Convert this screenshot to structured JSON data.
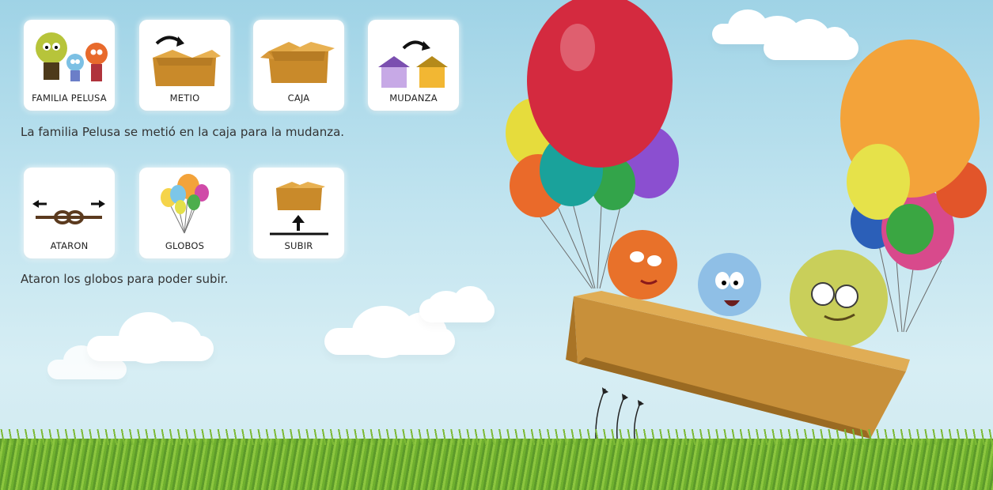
{
  "row1": {
    "cards": [
      {
        "label": "FAMILIA PELUSA",
        "icon": "pelusa-family-icon"
      },
      {
        "label": "METIO",
        "icon": "put-in-box-icon"
      },
      {
        "label": "CAJA",
        "icon": "box-icon"
      },
      {
        "label": "MUDANZA",
        "icon": "moving-house-icon"
      }
    ],
    "sentence": "La familia Pelusa se metió en la caja para la mudanza."
  },
  "row2": {
    "cards": [
      {
        "label": "ATARON",
        "icon": "tie-knot-icon"
      },
      {
        "label": "GLOBOS",
        "icon": "balloons-icon"
      },
      {
        "label": "SUBIR",
        "icon": "go-up-icon"
      }
    ],
    "sentence": "Ataron los globos para poder subir."
  },
  "illustration": {
    "name": "pelusa-family-balloon-box-illustration"
  },
  "colors": {
    "box": "#d9a13b",
    "sky": "#bfe3ef",
    "grass": "#7cb936",
    "red_balloon": "#d42a3f",
    "orange_balloon": "#f3a33a"
  }
}
